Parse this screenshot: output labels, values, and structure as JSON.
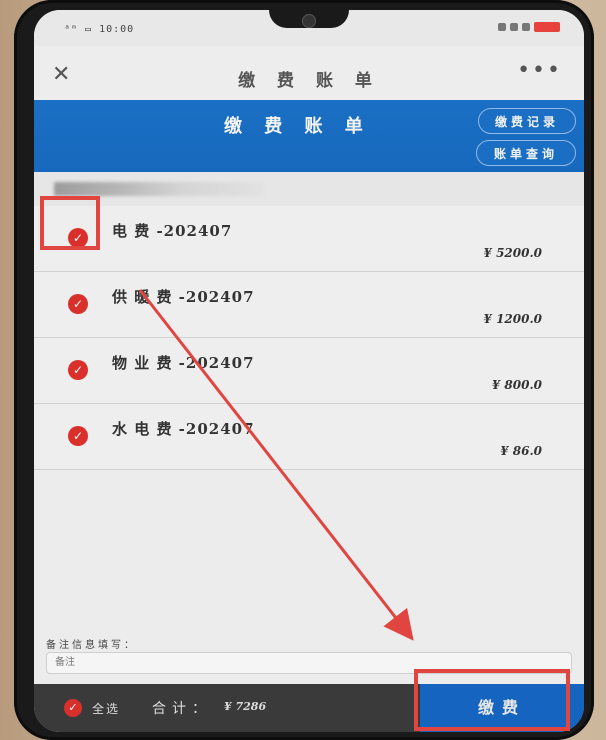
{
  "status_bar": {
    "left_text": "ᵃᵐ ▭ 10:00"
  },
  "title_bar": {
    "title": "缴 费 账 单",
    "close_icon": "close-icon",
    "more_icon": "more-icon"
  },
  "header": {
    "title": "缴 费 账 单",
    "button_one": "缴费记录",
    "button_two": "账单查询"
  },
  "bills": [
    {
      "name": "电 费 -202407",
      "amount": "¥ 5200.0"
    },
    {
      "name": "供 暖 费 -202407",
      "amount": "¥ 1200.0"
    },
    {
      "name": "物 业 费 -202407",
      "amount": "¥ 800.0"
    },
    {
      "name": "水 电 费 -202407",
      "amount": "¥ 86.0"
    }
  ],
  "remark": {
    "label": "备注信息填写：",
    "placeholder": "备注"
  },
  "bottom_bar": {
    "select_all": "全选",
    "total_label": "合计：",
    "total_value": "¥ 7286",
    "pay_label": "缴费"
  },
  "colors": {
    "header_blue": "#1a6fc4",
    "check_red": "#d9302c",
    "annotation_red": "#e0453f"
  }
}
